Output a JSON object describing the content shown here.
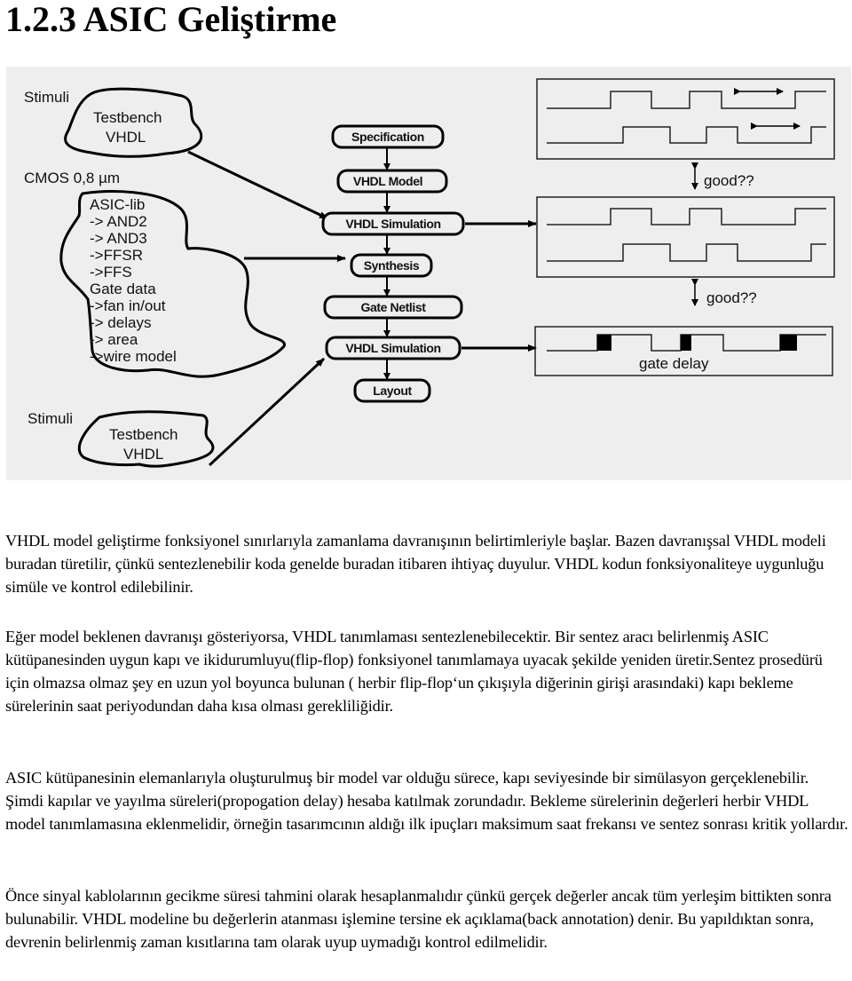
{
  "heading": "1.2.3 ASIC Geliştirme",
  "figure": {
    "left_labels": {
      "stimuli_top": "Stimuli",
      "testbench_top": [
        "Testbench",
        "VHDL"
      ],
      "cmos": "CMOS 0,8 µm",
      "asic_lib": [
        "ASIC-lib",
        "-> AND2",
        "-> AND3",
        "->FFSR",
        "->FFS",
        "Gate data",
        "->fan in/out",
        "-> delays",
        "-> area",
        "->wire model"
      ],
      "stimuli_bottom": "Stimuli",
      "testbench_bottom": [
        "Testbench",
        "VHDL"
      ]
    },
    "flow_steps": [
      "Specification",
      "VHDL Model",
      "VHDL Simulation",
      "Synthesis",
      "Gate Netlist",
      "VHDL Simulation",
      "Layout"
    ],
    "waveform_labels": {
      "good_1": "good??",
      "good_2": "good??",
      "gate_delay": "gate delay"
    },
    "colors": {
      "background": "#eeeeee",
      "stroke": "#000000"
    }
  },
  "paragraphs": [
    "VHDL model geliştirme fonksiyonel sınırlarıyla zamanlama davranışının belirtimleriyle başlar. Bazen davranışsal VHDL modeli buradan türetilir, çünkü sentezlenebilir koda genelde buradan itibaren ihtiyaç duyulur. VHDL kodun fonksiyonaliteye uygunluğu simüle ve kontrol edilebilinir.",
    "Eğer model beklenen davranışı gösteriyorsa, VHDL  tanımlaması  sentezlenebilecektir. Bir sentez aracı  belirlenmiş ASIC kütüpanesinden uygun kapı ve ikidurumluyu(flip-flop) fonksiyonel tanımlamaya uyacak şekilde yeniden üretir.Sentez prosedürü için olmazsa olmaz şey en uzun yol boyunca bulunan ( herbir flip-flop‘un çıkışıyla diğerinin girişi arasındaki)  kapı bekleme sürelerinin saat periyodundan daha kısa olması gerekliliğidir.",
    "ASIC kütüpanesinin elemanlarıyla oluşturulmuş bir model var olduğu sürece, kapı seviyesinde bir simülasyon gerçeklenebilir.  Şimdi kapılar ve yayılma süreleri(propogation delay) hesaba katılmak zorundadır.  Bekleme sürelerinin değerleri herbir VHDL model tanımlamasına eklenmelidir, örneğin tasarımcının aldığı ilk ipuçları maksimum saat frekansı ve sentez sonrası kritik yollardır.",
    "Önce sinyal kablolarının gecikme süresi tahmini olarak hesaplanmalıdır çünkü gerçek değerler ancak tüm yerleşim bittikten sonra bulunabilir. VHDL modeline bu değerlerin atanması işlemine tersine ek açıklama(back annotation) denir. Bu yapıldıktan sonra, devrenin belirlenmiş  zaman kısıtlarına tam olarak  uyup uymadığı kontrol edilmelidir."
  ]
}
